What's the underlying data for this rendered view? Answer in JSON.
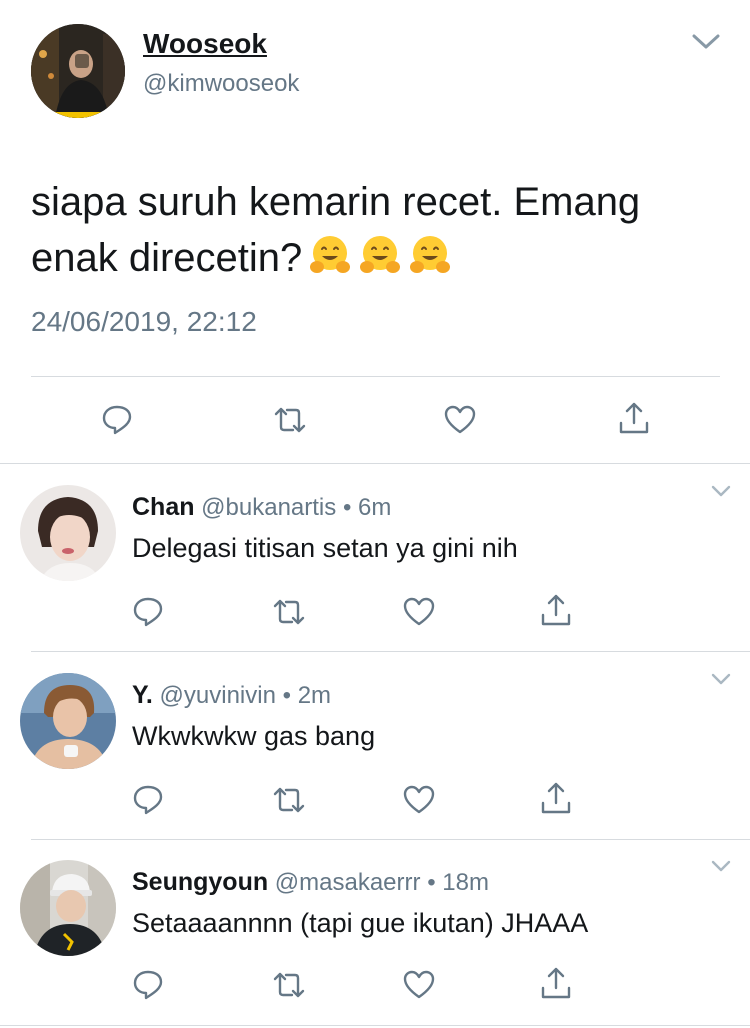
{
  "main_tweet": {
    "display_name": "Wooseok",
    "handle": "@kimwooseok",
    "text": "siapa suruh kemarin recet. Emang enak direcetin?",
    "emojis": [
      "hugging-face",
      "hugging-face",
      "hugging-face"
    ],
    "timestamp": "24/06/2019, 22:12"
  },
  "replies": [
    {
      "display_name": "Chan",
      "handle": "@bukanartis",
      "separator": "•",
      "time_ago": "6m",
      "text": "Delegasi titisan setan ya gini nih"
    },
    {
      "display_name": "Y.",
      "handle": "@yuvinivin",
      "separator": "•",
      "time_ago": "2m",
      "text": "Wkwkwkw gas bang"
    },
    {
      "display_name": "Seungyoun",
      "handle": "@masakaerrr",
      "separator": "•",
      "time_ago": "18m",
      "text": "Setaaaannnn (tapi gue ikutan) JHAAA"
    }
  ],
  "icons": {
    "reply": "reply-icon",
    "retweet": "retweet-icon",
    "like": "heart-icon",
    "share": "share-icon",
    "menu": "chevron-down-icon"
  },
  "colors": {
    "text_primary": "#14171a",
    "text_secondary": "#657786",
    "divider": "#d7dbdf",
    "icon": "#657786"
  }
}
